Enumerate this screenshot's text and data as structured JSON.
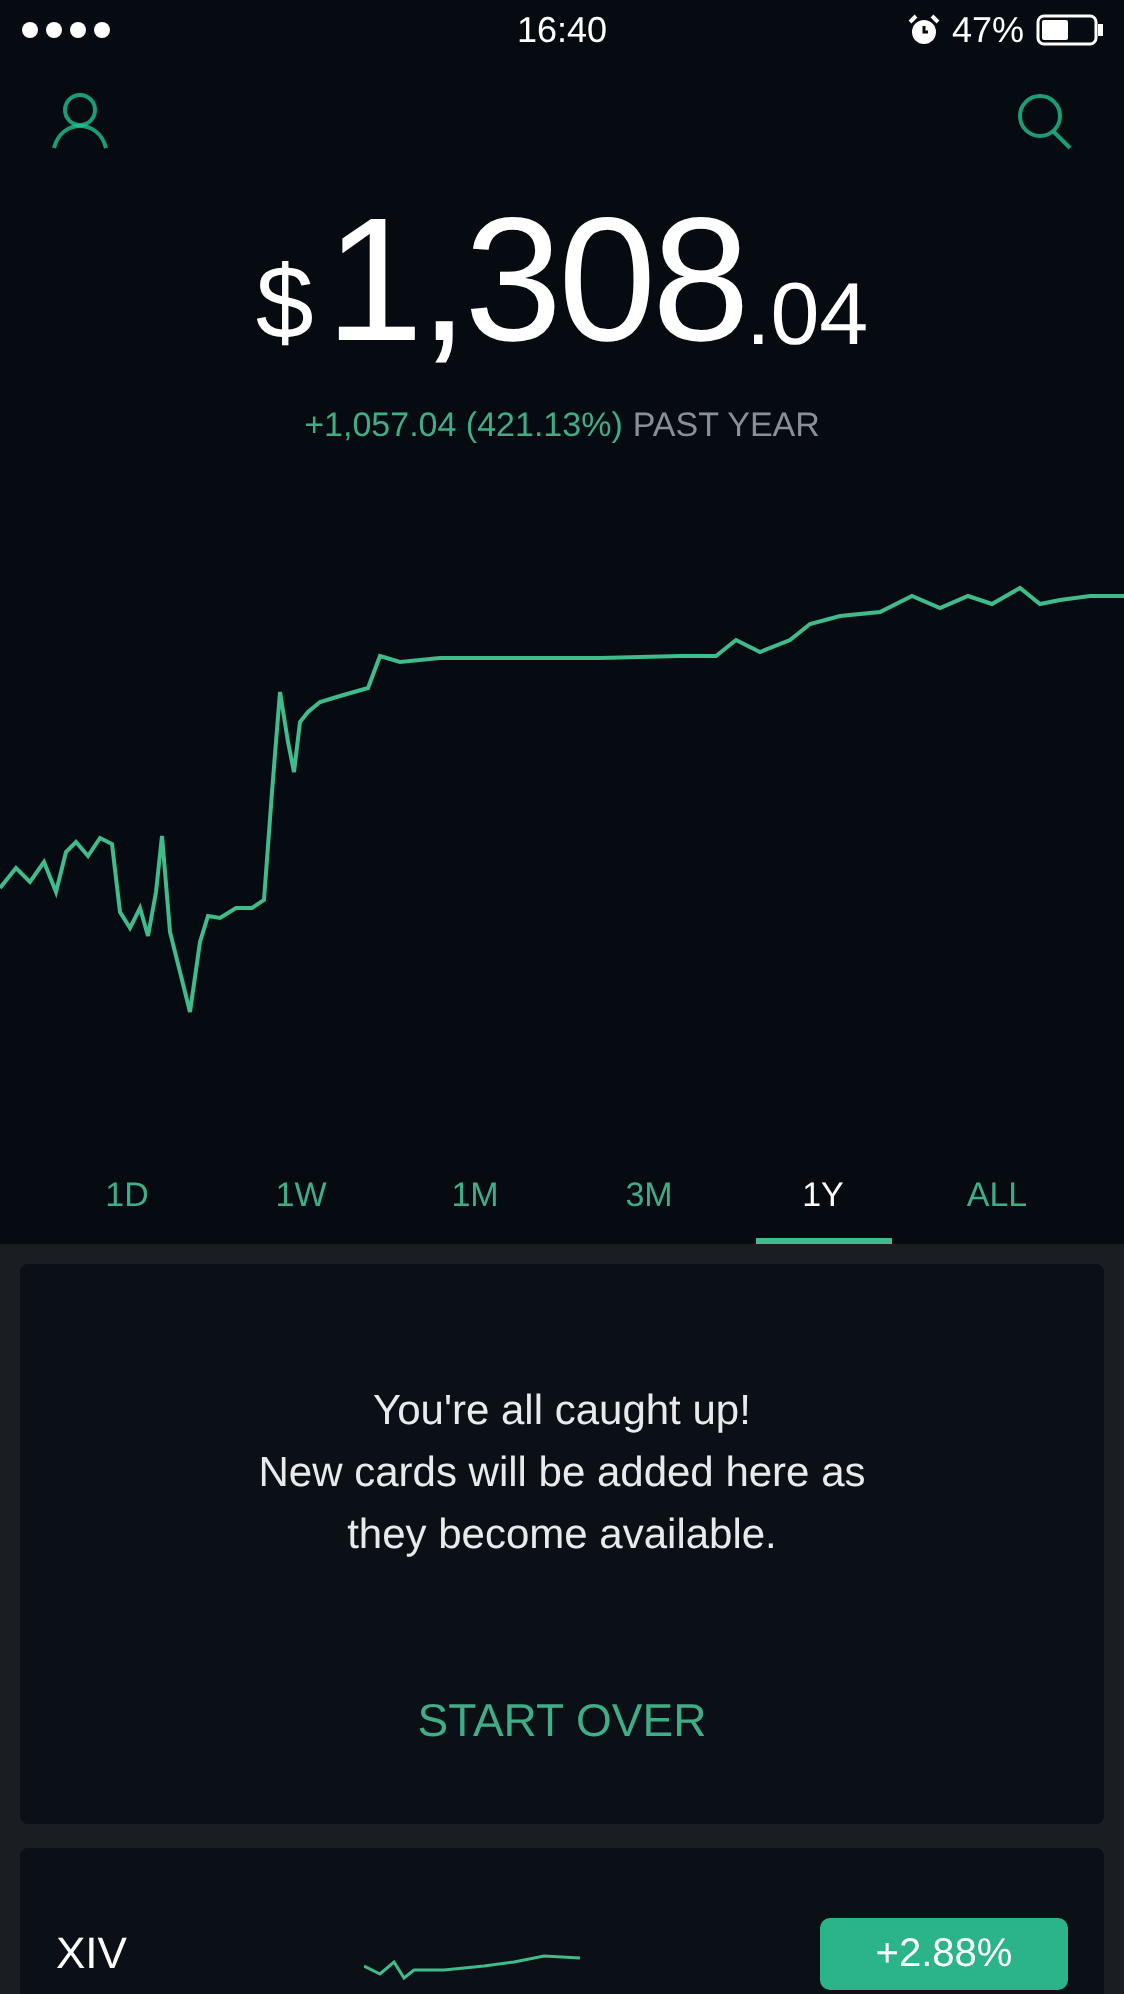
{
  "status_bar": {
    "time": "16:40",
    "battery": "47%"
  },
  "portfolio": {
    "currency": "$",
    "whole": "1,308",
    "cents": ".04",
    "change": "+1,057.04 (421.13%)",
    "period": "PAST YEAR"
  },
  "ranges": [
    {
      "label": "1D",
      "selected": false
    },
    {
      "label": "1W",
      "selected": false
    },
    {
      "label": "1M",
      "selected": false
    },
    {
      "label": "3M",
      "selected": false
    },
    {
      "label": "1Y",
      "selected": true
    },
    {
      "label": "ALL",
      "selected": false
    }
  ],
  "card": {
    "lines": [
      "You're all caught up!",
      "New cards will be added here as",
      "they become available."
    ],
    "action": "START OVER"
  },
  "watchlist": [
    {
      "symbol": "XIV",
      "change": "+2.88%"
    }
  ]
}
